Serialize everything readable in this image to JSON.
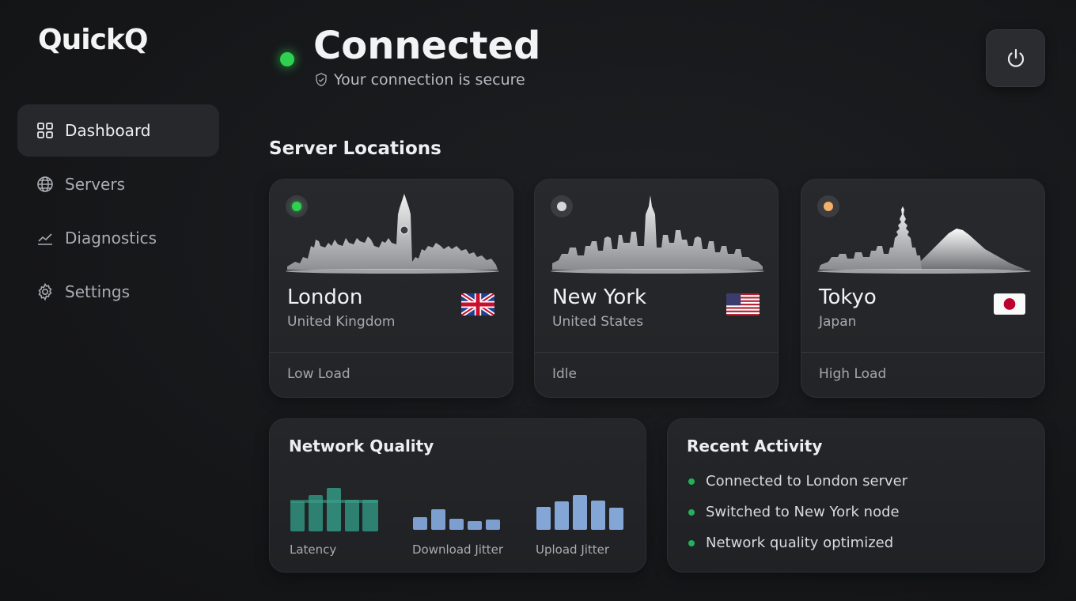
{
  "app": {
    "name": "QuickQ"
  },
  "sidebar": {
    "items": [
      {
        "label": "Dashboard",
        "icon": "grid-icon",
        "active": true
      },
      {
        "label": "Servers",
        "icon": "globe-icon",
        "active": false
      },
      {
        "label": "Diagnostics",
        "icon": "chart-line-icon",
        "active": false
      },
      {
        "label": "Settings",
        "icon": "gear-icon",
        "active": false
      }
    ]
  },
  "status": {
    "title": "Connected",
    "subtitle": "Your connection is secure",
    "dot_color": "#2fd24f"
  },
  "servers": {
    "title": "Server Locations",
    "cards": [
      {
        "city": "London",
        "country": "United Kingdom",
        "load": "Low Load",
        "indicator_color": "#2fd24f",
        "flag": "uk-flag-icon"
      },
      {
        "city": "New York",
        "country": "United States",
        "load": "Idle",
        "indicator_color": "#d6d6d6",
        "flag": "us-flag-icon"
      },
      {
        "city": "Tokyo",
        "country": "Japan",
        "load": "High Load",
        "indicator_color": "#f2b06a",
        "flag": "japan-flag-icon"
      }
    ]
  },
  "network_quality": {
    "title": "Network Quality",
    "metrics": [
      {
        "label": "Latency",
        "color": "#2e8070"
      },
      {
        "label": "Download Jitter",
        "color": "#7d9fcf"
      },
      {
        "label": "Upload Jitter",
        "color": "#84a6d6"
      }
    ]
  },
  "recent_activity": {
    "title": "Recent Activity",
    "items": [
      "Connected to London server",
      "Switched to New York node",
      "Network quality optimized"
    ]
  }
}
